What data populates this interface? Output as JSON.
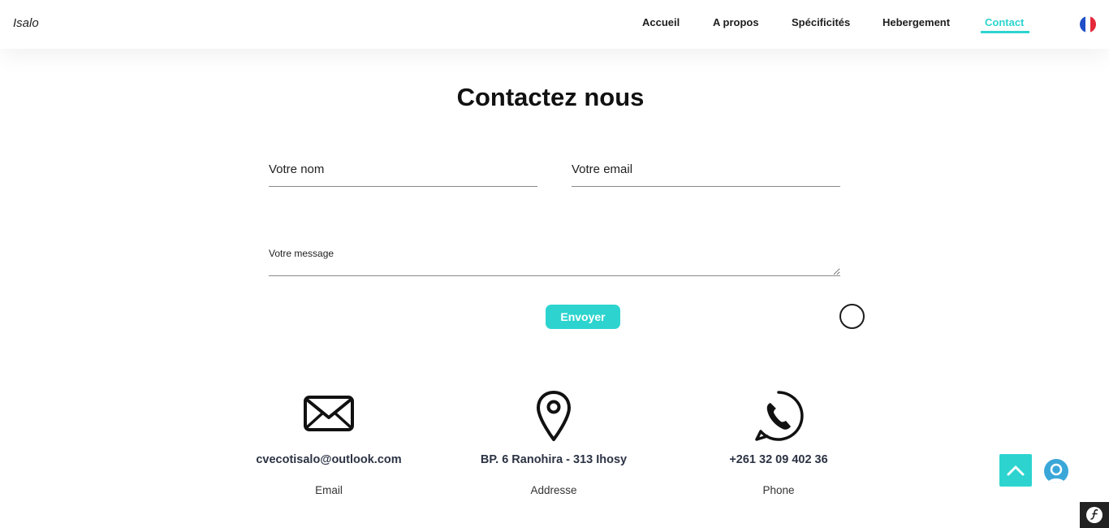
{
  "header": {
    "logo": "Isalo",
    "nav": [
      {
        "label": "Accueil",
        "active": false
      },
      {
        "label": "A propos",
        "active": false
      },
      {
        "label": "Spécificités",
        "active": false
      },
      {
        "label": "Hebergement",
        "active": false
      },
      {
        "label": "Contact",
        "active": true
      }
    ],
    "language_icon": "france-flag-icon"
  },
  "main": {
    "title": "Contactez nous",
    "form": {
      "name_placeholder": "Votre nom",
      "email_placeholder": "Votre email",
      "message_placeholder": "Votre message",
      "submit_label": "Envoyer"
    },
    "contacts": [
      {
        "icon": "envelope-icon",
        "value": "cvecotisalo@outlook.com",
        "label": "Email"
      },
      {
        "icon": "map-pin-icon",
        "value": "BP. 6 Ranohira - 313 Ihosy",
        "label": "Addresse"
      },
      {
        "icon": "phone-icon",
        "value": "+261 32 09 402 36",
        "label": "Phone"
      }
    ]
  },
  "colors": {
    "accent": "#2dd4cf",
    "text": "#1b1b1b",
    "info_text": "#2c3344"
  }
}
